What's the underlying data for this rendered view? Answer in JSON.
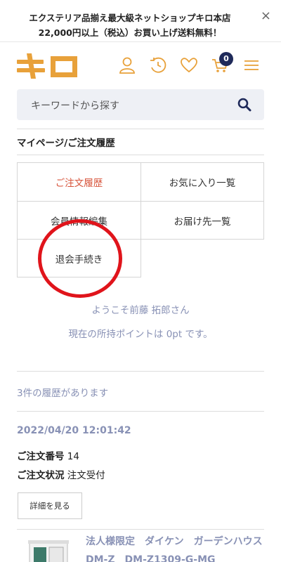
{
  "banner": {
    "line1": "エクステリア品揃え最大級ネットショップキロ本店",
    "line2": "22,000円以上（税込）お買い上げ送料無料！",
    "close_label": "×"
  },
  "header": {
    "logo_text": "キロ",
    "cart_count": "0",
    "icons": [
      "user-icon",
      "history-icon",
      "heart-icon",
      "cart-icon",
      "menu-icon"
    ]
  },
  "search": {
    "placeholder": "キーワードから探す",
    "icon": "search-icon"
  },
  "page": {
    "title": "マイページ/ご注文履歴"
  },
  "menu": {
    "items": [
      {
        "label": "ご注文履歴",
        "active": true
      },
      {
        "label": "お気に入り一覧"
      },
      {
        "label": "会員情報編集"
      },
      {
        "label": "お届け先一覧"
      },
      {
        "label": "退会手続き"
      }
    ]
  },
  "welcome": {
    "greeting": "ようこそ前藤 拓郎さん",
    "points": "現在の所持ポイントは 0pt です。"
  },
  "history": {
    "count_text": "3件の履歴があります"
  },
  "order": {
    "date": "2022/04/20 12:01:42",
    "number_label": "ご注文番号",
    "number_value": "14",
    "status_label": "ご注文状況",
    "status_value": "注文受付",
    "detail_button": "詳細を見る",
    "product_name": "法人様限定　ダイケン　ガーデンハウス　DM-Z　DM-Z1309-G-MG"
  },
  "colors": {
    "brand_orange": "#e8a13a",
    "accent_red": "#d7543b",
    "muted_blue": "#8891b5",
    "navy": "#1f2a5a",
    "annotation_circle": "#e0141b"
  }
}
